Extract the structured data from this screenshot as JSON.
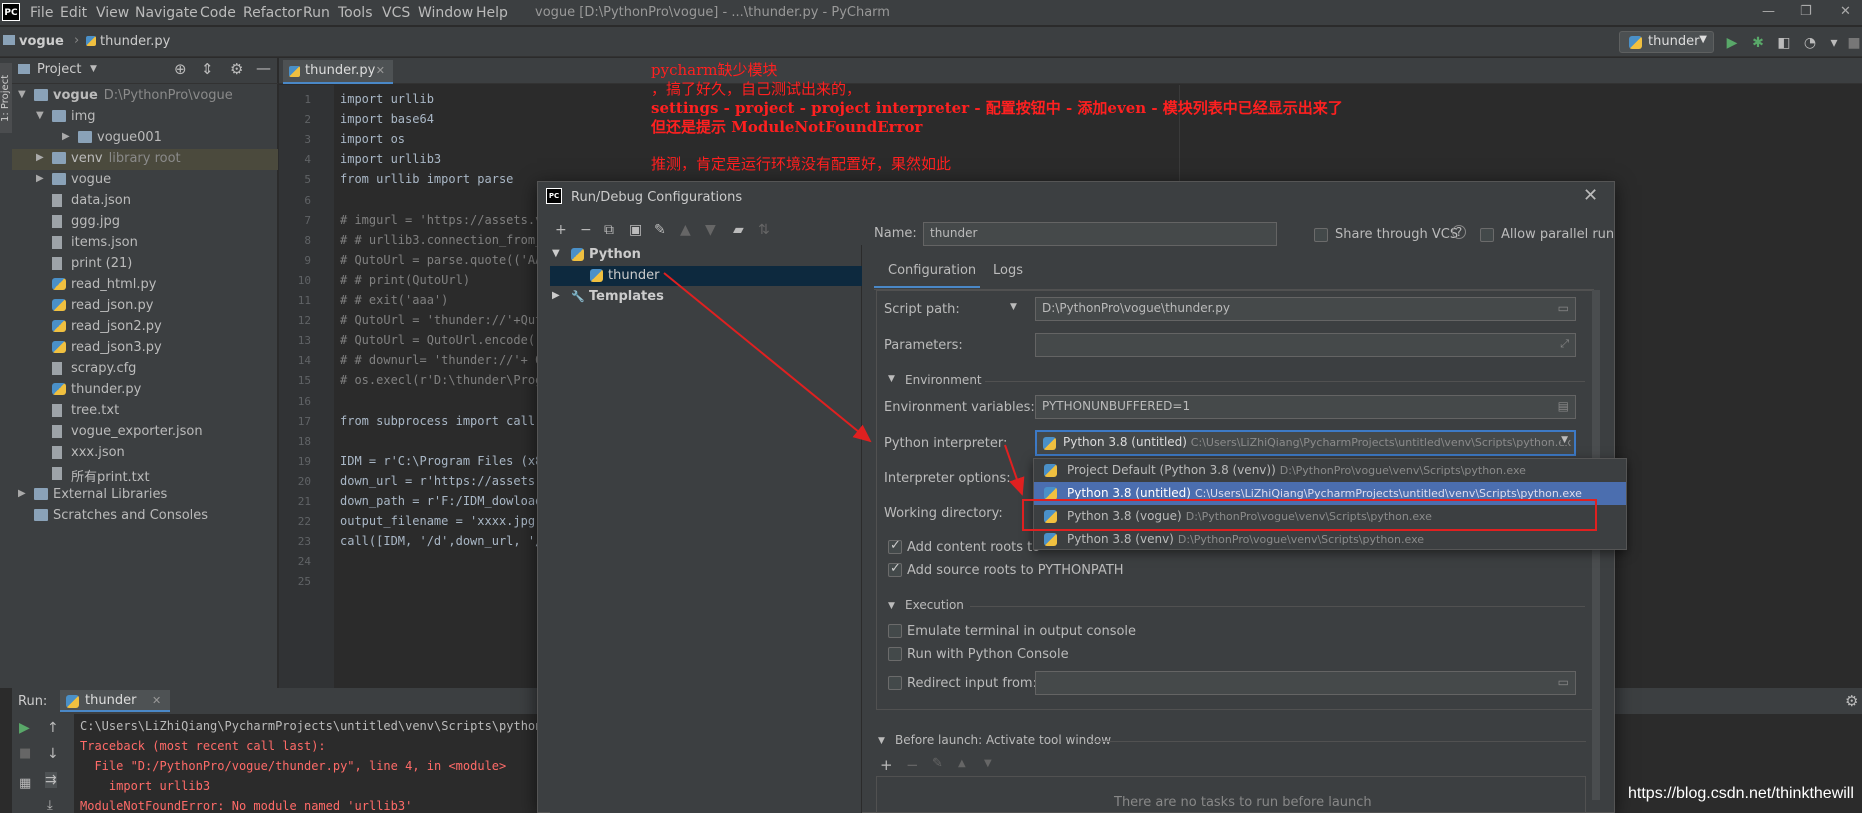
{
  "window": {
    "logo": "PC",
    "title": "vogue [D:\\PythonPro\\vogue] - ...\\thunder.py - PyCharm",
    "menu": [
      "File",
      "Edit",
      "View",
      "Navigate",
      "Code",
      "Refactor",
      "Run",
      "Tools",
      "VCS",
      "Window",
      "Help"
    ]
  },
  "navbar": {
    "crumbs": [
      "vogue",
      "thunder.py"
    ],
    "run_config": "thunder"
  },
  "left_strip": {
    "project_tab": "1: Project"
  },
  "project": {
    "header": "Project",
    "tree": [
      {
        "label": "vogue",
        "hint": "D:\\PythonPro\\vogue",
        "type": "folder",
        "expanded": true,
        "depth": 0
      },
      {
        "label": "img",
        "hint": "",
        "type": "folder",
        "expanded": true,
        "depth": 1
      },
      {
        "label": "vogue001",
        "hint": "",
        "type": "folder",
        "depth": 2
      },
      {
        "label": "venv",
        "hint": "library root",
        "type": "folder",
        "depth": 1,
        "selected": true
      },
      {
        "label": "vogue",
        "hint": "",
        "type": "folder",
        "depth": 1
      },
      {
        "label": "data.json",
        "hint": "",
        "type": "file",
        "depth": 1
      },
      {
        "label": "ggg.jpg",
        "hint": "",
        "type": "file",
        "depth": 1
      },
      {
        "label": "items.json",
        "hint": "",
        "type": "file",
        "depth": 1
      },
      {
        "label": "print (21)",
        "hint": "",
        "type": "file",
        "depth": 1
      },
      {
        "label": "read_html.py",
        "hint": "",
        "type": "py",
        "depth": 1
      },
      {
        "label": "read_json.py",
        "hint": "",
        "type": "py",
        "depth": 1
      },
      {
        "label": "read_json2.py",
        "hint": "",
        "type": "py",
        "depth": 1
      },
      {
        "label": "read_json3.py",
        "hint": "",
        "type": "py",
        "depth": 1
      },
      {
        "label": "scrapy.cfg",
        "hint": "",
        "type": "file",
        "depth": 1
      },
      {
        "label": "thunder.py",
        "hint": "",
        "type": "py",
        "depth": 1
      },
      {
        "label": "tree.txt",
        "hint": "",
        "type": "file",
        "depth": 1
      },
      {
        "label": "vogue_exporter.json",
        "hint": "",
        "type": "file",
        "depth": 1
      },
      {
        "label": "xxx.json",
        "hint": "",
        "type": "file",
        "depth": 1
      },
      {
        "label": "所有print.txt",
        "hint": "",
        "type": "file",
        "depth": 1
      },
      {
        "label": "External Libraries",
        "hint": "",
        "type": "lib",
        "depth": 0
      },
      {
        "label": "Scratches and Consoles",
        "hint": "",
        "type": "scratch",
        "depth": 0
      }
    ]
  },
  "editor": {
    "tab": "thunder.py",
    "lines": [
      "import urllib",
      "import base64",
      "import os",
      "import urllib3",
      "from urllib import parse",
      "",
      "# imgurl = 'https://assets.v",
      "# # urllib3.connection_from_",
      "# QutoUrl = parse.quote(('AA",
      "# # print(QutoUrl)",
      "# # exit('aaa')",
      "# QutoUrl = 'thunder://'+Qut",
      "# QutoUrl = QutoUrl.encode()",
      "# # downurl= 'thunder://'+ Q",
      "# os.execl(r'D:\\thunder\\Prog",
      "",
      "from subprocess import call",
      "",
      "IDM = r'C:\\Program Files (x8",
      "down_url = r'https://assets.",
      "down_path = r'F:/IDM_dowload",
      "output_filename = 'xxxx.jpg'",
      "call([IDM, '/d',down_url, '/",
      "",
      ""
    ]
  },
  "annotations": [
    "pycharm缺少模块",
    "，搞了好久，自己测试出来的，",
    "settings - project - project interpreter - 配置按钮中 - 添加even - 模块列表中已经显示出来了",
    "但还是提示 ModuleNotFoundError",
    "推测，肯定是运行环境没有配置好，果然如此"
  ],
  "run_panel": {
    "label": "Run:",
    "tab": "thunder",
    "lines": [
      {
        "text": "C:\\Users\\LiZhiQiang\\PycharmProjects\\untitled\\venv\\Scripts\\python.",
        "kind": "normal"
      },
      {
        "text": "Traceback (most recent call last):",
        "kind": "error"
      },
      {
        "text": "  File \"D:/PythonPro/vogue/thunder.py\", line 4, in <module>",
        "kind": "error"
      },
      {
        "text": "    import urllib3",
        "kind": "error"
      },
      {
        "text": "ModuleNotFoundError: No module named 'urllib3'",
        "kind": "error"
      }
    ]
  },
  "dialog": {
    "title": "Run/Debug Configurations",
    "tree": [
      {
        "label": "Python",
        "bold": true
      },
      {
        "label": "thunder",
        "selected": true
      },
      {
        "label": "Templates",
        "bold": true
      }
    ],
    "name_label": "Name:",
    "name_value": "thunder",
    "share_vcs": "Share through VCS",
    "allow_parallel": "Allow parallel run",
    "tabs": [
      "Configuration",
      "Logs"
    ],
    "script_path_label": "Script path:",
    "script_path": "D:\\PythonPro\\vogue\\thunder.py",
    "parameters_label": "Parameters:",
    "env_section": "Environment",
    "env_vars_label": "Environment variables:",
    "env_vars": "PYTHONUNBUFFERED=1",
    "interpreter_label": "Python interpreter:",
    "interpreter_value": "Python 3.8 (untitled)",
    "interpreter_path": "C:\\Users\\LiZhiQiang\\PycharmProjects\\untitled\\venv\\Scripts\\python.ex",
    "interpreter_options_label": "Interpreter options:",
    "working_dir_label": "Working directory:",
    "add_content_roots": "Add content roots to",
    "add_source_roots": "Add source roots to PYTHONPATH",
    "exec_section": "Execution",
    "emulate_terminal": "Emulate terminal in output console",
    "run_python_console": "Run with Python Console",
    "redirect_input": "Redirect input from:",
    "before_launch": "Before launch: Activate tool window",
    "no_tasks": "There are no tasks to run before launch",
    "dropdown": [
      {
        "label": "Project Default (Python 3.8 (venv))",
        "path": "D:\\PythonPro\\vogue\\venv\\Scripts\\python.exe",
        "selected": false
      },
      {
        "label": "Python 3.8 (untitled)",
        "path": "C:\\Users\\LiZhiQiang\\PycharmProjects\\untitled\\venv\\Scripts\\python.exe",
        "selected": true
      },
      {
        "label": "Python 3.8 (vogue)",
        "path": "D:\\PythonPro\\vogue\\venv\\Scripts\\python.exe",
        "selected": false
      },
      {
        "label": "Python 3.8 (venv)",
        "path": "D:\\PythonPro\\vogue\\venv\\Scripts\\python.exe",
        "selected": false
      }
    ]
  },
  "watermark": "https://blog.csdn.net/thinkthewill",
  "colors": {
    "annotation": "#ff2020",
    "selection": "#4b6eaf",
    "error": "#ff6b68"
  }
}
